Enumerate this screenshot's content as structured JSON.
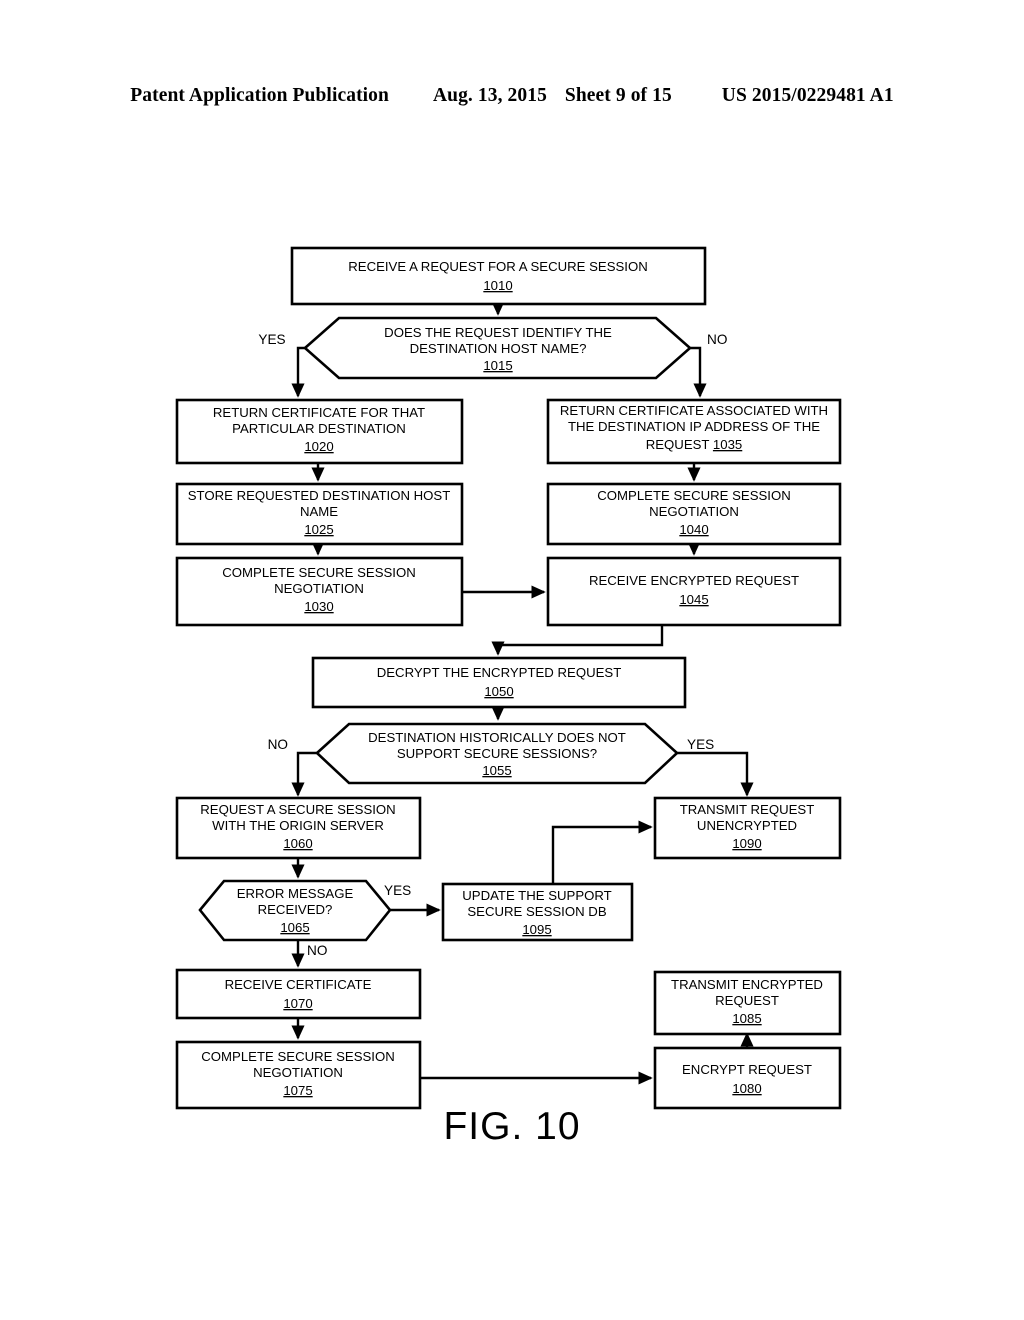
{
  "header": {
    "publication": "Patent Application Publication",
    "date": "Aug. 13, 2015",
    "sheet": "Sheet 9 of 15",
    "number": "US 2015/0229481 A1"
  },
  "figure": {
    "label": "FIG. 10"
  },
  "diagram": {
    "type": "flowchart",
    "nodes": [
      {
        "id": "1010",
        "shape": "process",
        "lines": [
          "RECEIVE A REQUEST FOR A SECURE SESSION"
        ],
        "ref": "1010",
        "ref_inline": false
      },
      {
        "id": "1015",
        "shape": "decision",
        "lines": [
          "DOES THE REQUEST IDENTIFY THE",
          "DESTINATION HOST NAME?"
        ],
        "ref": "1015",
        "ref_inline": false
      },
      {
        "id": "1020",
        "shape": "process",
        "lines": [
          "RETURN CERTIFICATE FOR THAT",
          "PARTICULAR DESTINATION"
        ],
        "ref": "1020",
        "ref_inline": false
      },
      {
        "id": "1025",
        "shape": "process",
        "lines": [
          "STORE REQUESTED DESTINATION HOST",
          "NAME"
        ],
        "ref": "1025",
        "ref_inline": false
      },
      {
        "id": "1030",
        "shape": "process",
        "lines": [
          "COMPLETE SECURE SESSION",
          "NEGOTIATION"
        ],
        "ref": "1030",
        "ref_inline": false
      },
      {
        "id": "1035",
        "shape": "process",
        "lines": [
          "RETURN CERTIFICATE ASSOCIATED WITH",
          "THE DESTINATION IP ADDRESS OF THE",
          "REQUEST"
        ],
        "ref": "1035",
        "ref_inline": true
      },
      {
        "id": "1040",
        "shape": "process",
        "lines": [
          "COMPLETE SECURE SESSION",
          "NEGOTIATION"
        ],
        "ref": "1040",
        "ref_inline": false
      },
      {
        "id": "1045",
        "shape": "process",
        "lines": [
          "RECEIVE ENCRYPTED REQUEST"
        ],
        "ref": "1045",
        "ref_inline": false
      },
      {
        "id": "1050",
        "shape": "process",
        "lines": [
          "DECRYPT THE ENCRYPTED REQUEST"
        ],
        "ref": "1050",
        "ref_inline": false
      },
      {
        "id": "1055",
        "shape": "decision",
        "lines": [
          "DESTINATION HISTORICALLY DOES NOT",
          "SUPPORT SECURE SESSIONS?"
        ],
        "ref": "1055",
        "ref_inline": false
      },
      {
        "id": "1060",
        "shape": "process",
        "lines": [
          "REQUEST A SECURE SESSION",
          "WITH THE ORIGIN SERVER"
        ],
        "ref": "1060",
        "ref_inline": false
      },
      {
        "id": "1065",
        "shape": "decision",
        "lines": [
          "ERROR MESSAGE",
          "RECEIVED?"
        ],
        "ref": "1065",
        "ref_inline": false
      },
      {
        "id": "1070",
        "shape": "process",
        "lines": [
          "RECEIVE CERTIFICATE"
        ],
        "ref": "1070",
        "ref_inline": false
      },
      {
        "id": "1075",
        "shape": "process",
        "lines": [
          "COMPLETE SECURE SESSION",
          "NEGOTIATION"
        ],
        "ref": "1075",
        "ref_inline": false
      },
      {
        "id": "1080",
        "shape": "process",
        "lines": [
          "ENCRYPT REQUEST"
        ],
        "ref": "1080",
        "ref_inline": false
      },
      {
        "id": "1085",
        "shape": "process",
        "lines": [
          "TRANSMIT ENCRYPTED",
          "REQUEST"
        ],
        "ref": "1085",
        "ref_inline": false
      },
      {
        "id": "1090",
        "shape": "process",
        "lines": [
          "TRANSMIT REQUEST",
          "UNENCRYPTED"
        ],
        "ref": "1090",
        "ref_inline": false
      },
      {
        "id": "1095",
        "shape": "process",
        "lines": [
          "UPDATE THE SUPPORT",
          "SECURE SESSION DB"
        ],
        "ref": "1095",
        "ref_inline": false
      }
    ],
    "edge_labels": {
      "d1015_yes": "YES",
      "d1015_no": "NO",
      "d1055_no": "NO",
      "d1055_yes": "YES",
      "d1065_yes": "YES",
      "d1065_no": "NO"
    }
  }
}
